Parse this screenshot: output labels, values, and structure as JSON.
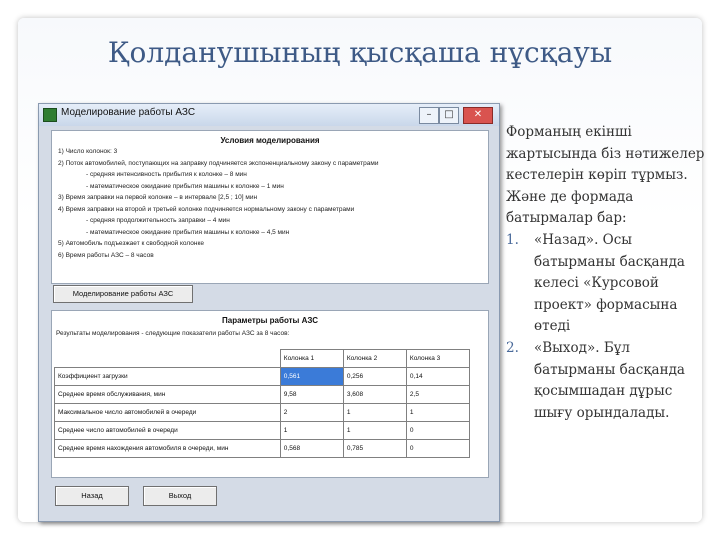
{
  "slide": {
    "title": "Қолданушының қысқаша нұсқауы",
    "para": "Форманың екінші жартысында біз нәтижелер кестелерін көріп тұрмыз. Және де формада батырмалар бар:",
    "items": [
      {
        "num": "1.",
        "text": "«Назад». Осы батырманы басқанда келесі «Курсовой проект» формасына өтеді"
      },
      {
        "num": "2.",
        "text": "«Выход». Бұл батырманы басқанда қосымшадан дұрыс шығу орындалады."
      }
    ]
  },
  "window": {
    "title": "Моделирование работы АЗС",
    "controls": {
      "minimize": "–",
      "maximize": "□",
      "close": "✕"
    },
    "conditions": {
      "heading": "Условия моделирования",
      "lines": [
        "1) Число колонок: 3",
        "2) Поток автомобилей, поступающих на заправку подчиняется экспоненциальному закону с параметрами",
        "- средняя интенсивность прибытия к колонке – 8 мин",
        "- математическое ожидание прибытия машины к колонке – 1 мин",
        "3) Время заправки на первой колонке – в интервале [2,5 ; 10] мин",
        "4) Время заправки на второй и третьей колонке подчиняется нормальному закону с параметрами",
        "- средняя продолжительность заправки – 4 мин",
        "- математическое ожидание прибытия машины к колонке – 4,5 мин",
        "5) Автомобиль подъезжает к свободной колонке",
        "6) Время работы АЗС – 8 часов"
      ]
    },
    "model_button": "Моделирование работы АЗС",
    "params": {
      "heading": "Параметры работы АЗС",
      "subheading": "Результаты моделирования - следующие показатели работы АЗС за 8 часов:",
      "columns": [
        "Колонка 1",
        "Колонка 2",
        "Колонка 3"
      ],
      "rows": [
        {
          "label": "Коэффициент загрузки",
          "values": [
            "0,561",
            "0,256",
            "0,14"
          ]
        },
        {
          "label": "Среднее время обслуживания, мин",
          "values": [
            "9,58",
            "3,608",
            "2,5"
          ]
        },
        {
          "label": "Максимальное число автомобилей в очереди",
          "values": [
            "2",
            "1",
            "1"
          ]
        },
        {
          "label": "Среднее число автомобилей в очереди",
          "values": [
            "1",
            "1",
            "0"
          ]
        },
        {
          "label": "Среднее время нахождения автомобиля в очереди, мин",
          "values": [
            "0,568",
            "0,785",
            "0"
          ]
        }
      ]
    },
    "buttons": {
      "back": "Назад",
      "exit": "Выход"
    }
  },
  "colors": {
    "title": "#3e5a86",
    "selection": "#3b7bd8",
    "list_number": "#4a6a9a"
  }
}
